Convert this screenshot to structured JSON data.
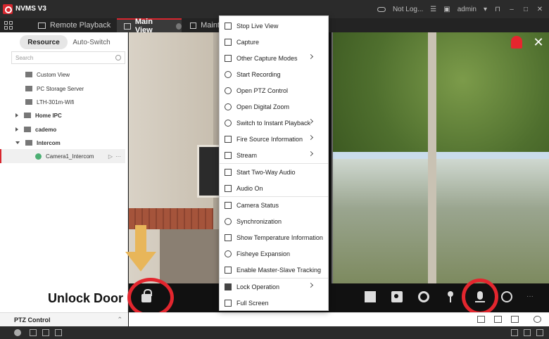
{
  "app": {
    "title": "NVMS V3"
  },
  "titlebar": {
    "cloud_status": "Not Log...",
    "user": "admin"
  },
  "tabs": [
    {
      "label": "Remote Playback"
    },
    {
      "label": "Main View"
    },
    {
      "label": "Maint"
    }
  ],
  "left_panel": {
    "segments": {
      "resource": "Resource",
      "auto_switch": "Auto-Switch"
    },
    "search_placeholder": "Search",
    "tree": [
      {
        "label": "Custom View"
      },
      {
        "label": "PC Storage Server"
      },
      {
        "label": "LTH-301m-Wifi"
      },
      {
        "label": "Home IPC"
      },
      {
        "label": "cademo"
      },
      {
        "label": "Intercom"
      },
      {
        "label": "Camera1_Intercom"
      }
    ],
    "ptz_label": "PTZ Control"
  },
  "context_menu": {
    "items": [
      "Stop Live View",
      "Capture",
      "Other Capture Modes",
      "Start Recording",
      "Open PTZ Control",
      "Open Digital Zoom",
      "Switch to Instant Playback",
      "Fire Source Information",
      "Stream",
      "Start Two-Way Audio",
      "Audio On",
      "Camera Status",
      "Synchronization",
      "Show Temperature Information",
      "Fisheye Expansion",
      "Enable Master-Slave Tracking",
      "Lock Operation",
      "Full Screen"
    ]
  },
  "annotation": {
    "unlock_door": "Unlock Door"
  },
  "colors": {
    "accent": "#d8262e",
    "annotation_circle": "#e3262e",
    "arrow": "#e8b65a"
  }
}
